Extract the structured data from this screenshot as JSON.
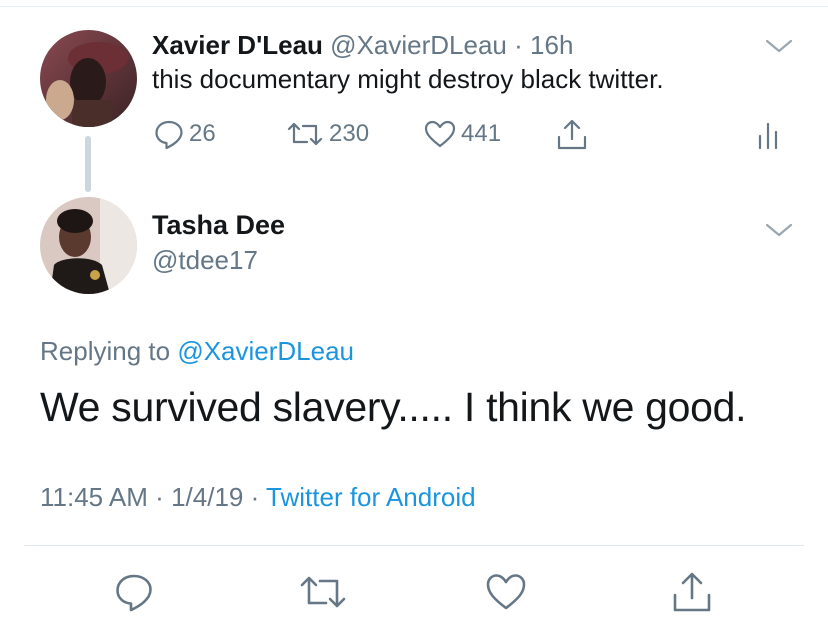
{
  "parent_tweet": {
    "name": "Xavier D'Leau",
    "handle": "@XavierDLeau",
    "separator": "·",
    "time": "16h",
    "text": "this documentary might destroy black twitter.",
    "replies": "26",
    "retweets": "230",
    "likes": "441",
    "avatar_icon": "user-avatar",
    "menu_icon": "chevron-down-icon"
  },
  "main_tweet": {
    "name": "Tasha Dee",
    "handle": "@tdee17",
    "replying_prefix": "Replying to",
    "replying_mention": "@XavierDLeau",
    "text": "We survived slavery..... I think we good.",
    "time": "11:45 AM",
    "date": "1/4/19",
    "separator": "·",
    "source": "Twitter for Android"
  },
  "action_bar": {
    "icons": [
      "reply-icon",
      "retweet-icon",
      "like-icon",
      "share-icon"
    ]
  },
  "colors": {
    "text": "#14171a",
    "muted": "#657786",
    "link": "#1b95e0",
    "divider": "#e6ecf0",
    "thread_line": "#ccd6dd"
  }
}
